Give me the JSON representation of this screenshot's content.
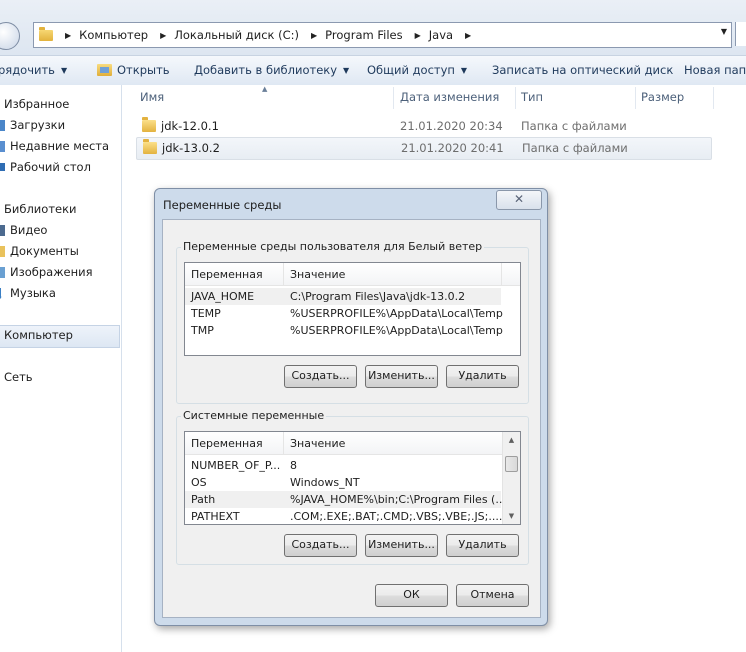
{
  "address_bar": {
    "crumbs": [
      "Компьютер",
      "Локальный диск (C:)",
      "Program Files",
      "Java"
    ]
  },
  "toolbar": {
    "organize": "рядочить",
    "open": "Открыть",
    "add_to_library": "Добавить в библиотеку",
    "share": "Общий доступ",
    "burn": "Записать на оптический диск",
    "new_folder": "Новая папк"
  },
  "nav": {
    "favorites": "Избранное",
    "downloads": "Загрузки",
    "recent": "Недавние места",
    "desktop": "Рабочий стол",
    "libraries": "Библиотеки",
    "videos": "Видео",
    "documents": "Документы",
    "images": "Изображения",
    "music": "Музыка",
    "computer": "Компьютер",
    "network": "Сеть"
  },
  "columns": {
    "name": "Имя",
    "date": "Дата изменения",
    "type": "Тип",
    "size": "Размер"
  },
  "files": [
    {
      "name": "jdk-12.0.1",
      "date": "21.01.2020 20:34",
      "type": "Папка с файлами"
    },
    {
      "name": "jdk-13.0.2",
      "date": "21.01.2020 20:41",
      "type": "Папка с файлами"
    }
  ],
  "dialog": {
    "title": "Переменные среды",
    "close_glyph": "✕",
    "user_group_label": "Переменные среды пользователя для Белый ветер",
    "col_variable": "Переменная",
    "col_value": "Значение",
    "user_vars": [
      {
        "name": "JAVA_HOME",
        "value": "C:\\Program Files\\Java\\jdk-13.0.2"
      },
      {
        "name": "TEMP",
        "value": "%USERPROFILE%\\AppData\\Local\\Temp"
      },
      {
        "name": "TMP",
        "value": "%USERPROFILE%\\AppData\\Local\\Temp"
      }
    ],
    "system_group_label": "Системные переменные",
    "system_vars": [
      {
        "name": "NUMBER_OF_P...",
        "value": "8"
      },
      {
        "name": "OS",
        "value": "Windows_NT"
      },
      {
        "name": "Path",
        "value": "%JAVA_HOME%\\bin;C:\\Program Files (..."
      },
      {
        "name": "PATHEXT",
        "value": ".COM;.EXE;.BAT;.CMD;.VBS;.VBE;.JS;...."
      }
    ],
    "create": "Создать...",
    "edit": "Изменить...",
    "delete": "Удалить",
    "ok": "ОК",
    "cancel": "Отмена"
  }
}
